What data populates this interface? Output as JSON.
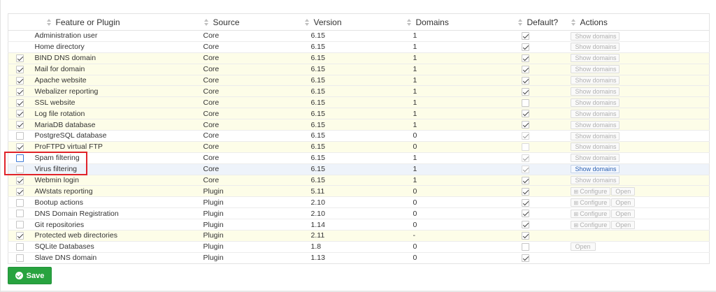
{
  "table": {
    "headers": {
      "feature": "Feature or Plugin",
      "source": "Source",
      "version": "Version",
      "domains": "Domains",
      "default": "Default?",
      "actions": "Actions"
    },
    "rows": [
      {
        "enabled": null,
        "name": "Administration user",
        "source": "Core",
        "version": "6.15",
        "domains": "1",
        "default": true,
        "default_dim": false,
        "highlight": false,
        "selected": false,
        "actions": {
          "type": "show",
          "label": "Show domains",
          "active": false
        }
      },
      {
        "enabled": null,
        "name": "Home directory",
        "source": "Core",
        "version": "6.15",
        "domains": "1",
        "default": true,
        "default_dim": false,
        "highlight": false,
        "selected": false,
        "actions": {
          "type": "show",
          "label": "Show domains",
          "active": false
        }
      },
      {
        "enabled": true,
        "name": "BIND DNS domain",
        "source": "Core",
        "version": "6.15",
        "domains": "1",
        "default": true,
        "default_dim": false,
        "highlight": true,
        "selected": false,
        "actions": {
          "type": "show",
          "label": "Show domains",
          "active": false
        }
      },
      {
        "enabled": true,
        "name": "Mail for domain",
        "source": "Core",
        "version": "6.15",
        "domains": "1",
        "default": true,
        "default_dim": false,
        "highlight": true,
        "selected": false,
        "actions": {
          "type": "show",
          "label": "Show domains",
          "active": false
        }
      },
      {
        "enabled": true,
        "name": "Apache website",
        "source": "Core",
        "version": "6.15",
        "domains": "1",
        "default": true,
        "default_dim": false,
        "highlight": true,
        "selected": false,
        "actions": {
          "type": "show",
          "label": "Show domains",
          "active": false
        }
      },
      {
        "enabled": true,
        "name": "Webalizer reporting",
        "source": "Core",
        "version": "6.15",
        "domains": "1",
        "default": true,
        "default_dim": false,
        "highlight": true,
        "selected": false,
        "actions": {
          "type": "show",
          "label": "Show domains",
          "active": false
        }
      },
      {
        "enabled": true,
        "name": "SSL website",
        "source": "Core",
        "version": "6.15",
        "domains": "1",
        "default": false,
        "default_dim": false,
        "highlight": true,
        "selected": false,
        "actions": {
          "type": "show",
          "label": "Show domains",
          "active": false
        }
      },
      {
        "enabled": true,
        "name": "Log file rotation",
        "source": "Core",
        "version": "6.15",
        "domains": "1",
        "default": true,
        "default_dim": false,
        "highlight": true,
        "selected": false,
        "actions": {
          "type": "show",
          "label": "Show domains",
          "active": false
        }
      },
      {
        "enabled": true,
        "name": "MariaDB database",
        "source": "Core",
        "version": "6.15",
        "domains": "1",
        "default": true,
        "default_dim": false,
        "highlight": true,
        "selected": false,
        "actions": {
          "type": "show",
          "label": "Show domains",
          "active": false
        }
      },
      {
        "enabled": false,
        "name": "PostgreSQL database",
        "source": "Core",
        "version": "6.15",
        "domains": "0",
        "default": true,
        "default_dim": true,
        "highlight": false,
        "selected": false,
        "actions": {
          "type": "show",
          "label": "Show domains",
          "active": false
        }
      },
      {
        "enabled": true,
        "name": "ProFTPD virtual FTP",
        "source": "Core",
        "version": "6.15",
        "domains": "0",
        "default": false,
        "default_dim": true,
        "highlight": true,
        "selected": false,
        "actions": {
          "type": "show",
          "label": "Show domains",
          "active": false
        }
      },
      {
        "enabled": false,
        "focus": true,
        "name": "Spam filtering",
        "source": "Core",
        "version": "6.15",
        "domains": "1",
        "default": true,
        "default_dim": true,
        "highlight": false,
        "selected": false,
        "actions": {
          "type": "show",
          "label": "Show domains",
          "active": false
        }
      },
      {
        "enabled": false,
        "name": "Virus filtering",
        "source": "Core",
        "version": "6.15",
        "domains": "1",
        "default": true,
        "default_dim": true,
        "highlight": false,
        "selected": true,
        "actions": {
          "type": "show",
          "label": "Show domains",
          "active": true
        }
      },
      {
        "enabled": true,
        "name": "Webmin login",
        "source": "Core",
        "version": "6.15",
        "domains": "1",
        "default": true,
        "default_dim": false,
        "highlight": true,
        "selected": false,
        "actions": {
          "type": "show",
          "label": "Show domains",
          "active": false
        }
      },
      {
        "enabled": true,
        "name": "AWstats reporting",
        "source": "Plugin",
        "version": "5.11",
        "domains": "0",
        "default": true,
        "default_dim": false,
        "highlight": true,
        "selected": false,
        "actions": {
          "type": "config",
          "label": "Configure",
          "open": "Open"
        }
      },
      {
        "enabled": false,
        "name": "Bootup actions",
        "source": "Plugin",
        "version": "2.10",
        "domains": "0",
        "default": true,
        "default_dim": false,
        "highlight": false,
        "selected": false,
        "actions": {
          "type": "config",
          "label": "Configure",
          "open": "Open"
        }
      },
      {
        "enabled": false,
        "name": "DNS Domain Registration",
        "source": "Plugin",
        "version": "2.10",
        "domains": "0",
        "default": true,
        "default_dim": false,
        "highlight": false,
        "selected": false,
        "actions": {
          "type": "config",
          "label": "Configure",
          "open": "Open"
        }
      },
      {
        "enabled": false,
        "name": "Git repositories",
        "source": "Plugin",
        "version": "1.14",
        "domains": "0",
        "default": true,
        "default_dim": false,
        "highlight": false,
        "selected": false,
        "actions": {
          "type": "config",
          "label": "Configure",
          "open": "Open"
        }
      },
      {
        "enabled": true,
        "name": "Protected web directories",
        "source": "Plugin",
        "version": "2.11",
        "domains": "-",
        "default": true,
        "default_dim": false,
        "highlight": true,
        "selected": false,
        "actions": {
          "type": "none"
        }
      },
      {
        "enabled": false,
        "name": "SQLite Databases",
        "source": "Plugin",
        "version": "1.8",
        "domains": "0",
        "default": false,
        "default_dim": false,
        "highlight": false,
        "selected": false,
        "actions": {
          "type": "open",
          "open": "Open"
        }
      },
      {
        "enabled": false,
        "name": "Slave DNS domain",
        "source": "Plugin",
        "version": "1.13",
        "domains": "0",
        "default": true,
        "default_dim": false,
        "highlight": false,
        "selected": false,
        "actions": {
          "type": "none"
        }
      }
    ]
  },
  "save_button": {
    "label": "Save",
    "icon": "check-circle-icon",
    "color": "#28a33f"
  },
  "colors": {
    "highlight_row": "#fdfde8",
    "selected_row": "#eef3fa",
    "annotation_box": "#e0232a"
  }
}
